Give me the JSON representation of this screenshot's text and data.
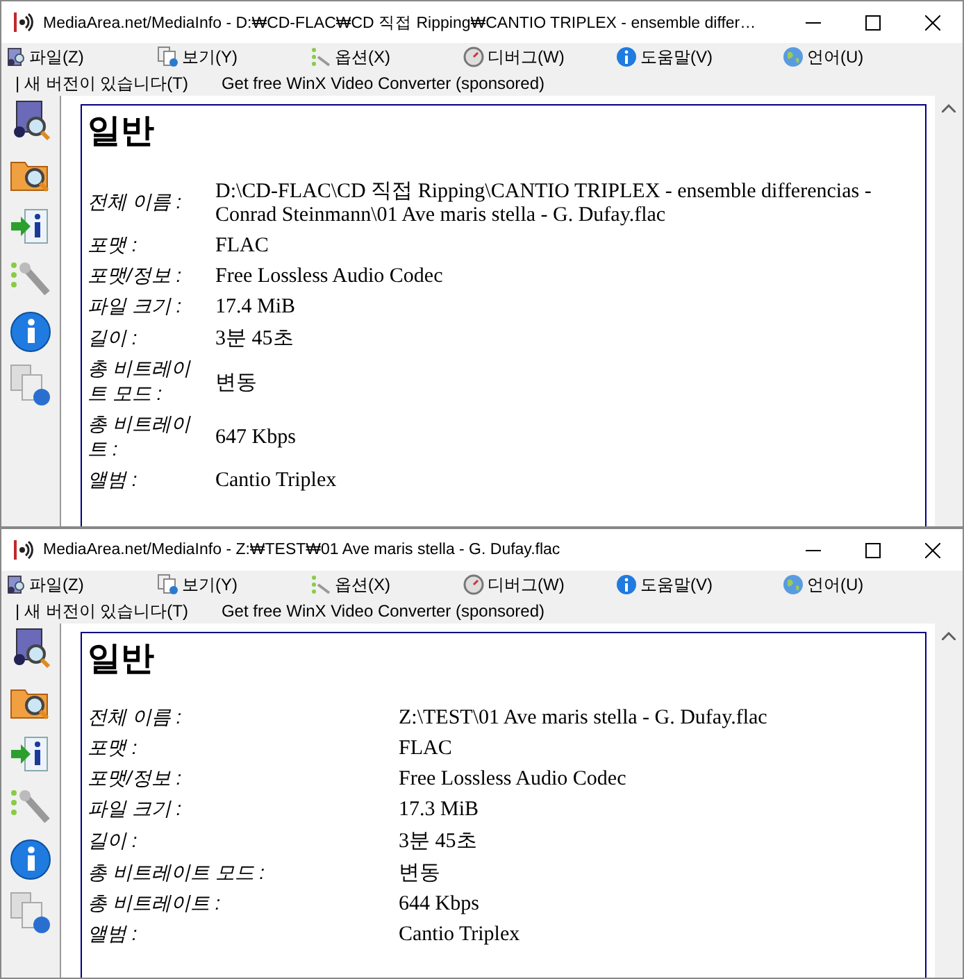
{
  "windows": [
    {
      "title": "MediaArea.net/MediaInfo - D:₩CD-FLAC₩CD 직접 Ripping₩CANTIO TRIPLEX - ensemble differ…",
      "menu": [
        "파일(Z)",
        "보기(Y)",
        "옵션(X)",
        "디버그(W)",
        "도움말(V)",
        "언어(U)"
      ],
      "links": [
        "| 새 버전이 있습니다(T)",
        "Get free WinX Video Converter (sponsored)"
      ],
      "section": "일반",
      "wrap_labels": true,
      "fields": [
        {
          "label": "전체 이름 :",
          "value": "D:\\CD-FLAC\\CD 직접 Ripping\\CANTIO TRIPLEX - ensemble differencias - Conrad Steinmann\\01 Ave maris stella - G. Dufay.flac"
        },
        {
          "label": "포맷 :",
          "value": "FLAC"
        },
        {
          "label": "포맷/정보 :",
          "value": "Free Lossless Audio Codec"
        },
        {
          "label": "파일 크기 :",
          "value": "17.4 MiB"
        },
        {
          "label": "길이 :",
          "value": "3분 45초"
        },
        {
          "label": "총 비트레이트 모드 :",
          "value": "변동"
        },
        {
          "label": "총 비트레이트 :",
          "value": "647 Kbps"
        },
        {
          "label": "앨범 :",
          "value": "Cantio Triplex"
        }
      ]
    },
    {
      "title": "MediaArea.net/MediaInfo - Z:₩TEST₩01 Ave maris stella - G. Dufay.flac",
      "menu": [
        "파일(Z)",
        "보기(Y)",
        "옵션(X)",
        "디버그(W)",
        "도움말(V)",
        "언어(U)"
      ],
      "links": [
        "| 새 버전이 있습니다(T)",
        "Get free WinX Video Converter (sponsored)"
      ],
      "section": "일반",
      "wrap_labels": false,
      "fields": [
        {
          "label": "전체 이름 :",
          "value": "Z:\\TEST\\01 Ave maris stella - G. Dufay.flac"
        },
        {
          "label": "포맷 :",
          "value": "FLAC"
        },
        {
          "label": "포맷/정보 :",
          "value": "Free Lossless Audio Codec"
        },
        {
          "label": "파일 크기 :",
          "value": "17.3 MiB"
        },
        {
          "label": "길이 :",
          "value": "3분 45초"
        },
        {
          "label": "총 비트레이트 모드 :",
          "value": "변동"
        },
        {
          "label": "총 비트레이트 :",
          "value": "644 Kbps"
        },
        {
          "label": "앨범 :",
          "value": "Cantio Triplex"
        }
      ]
    }
  ]
}
